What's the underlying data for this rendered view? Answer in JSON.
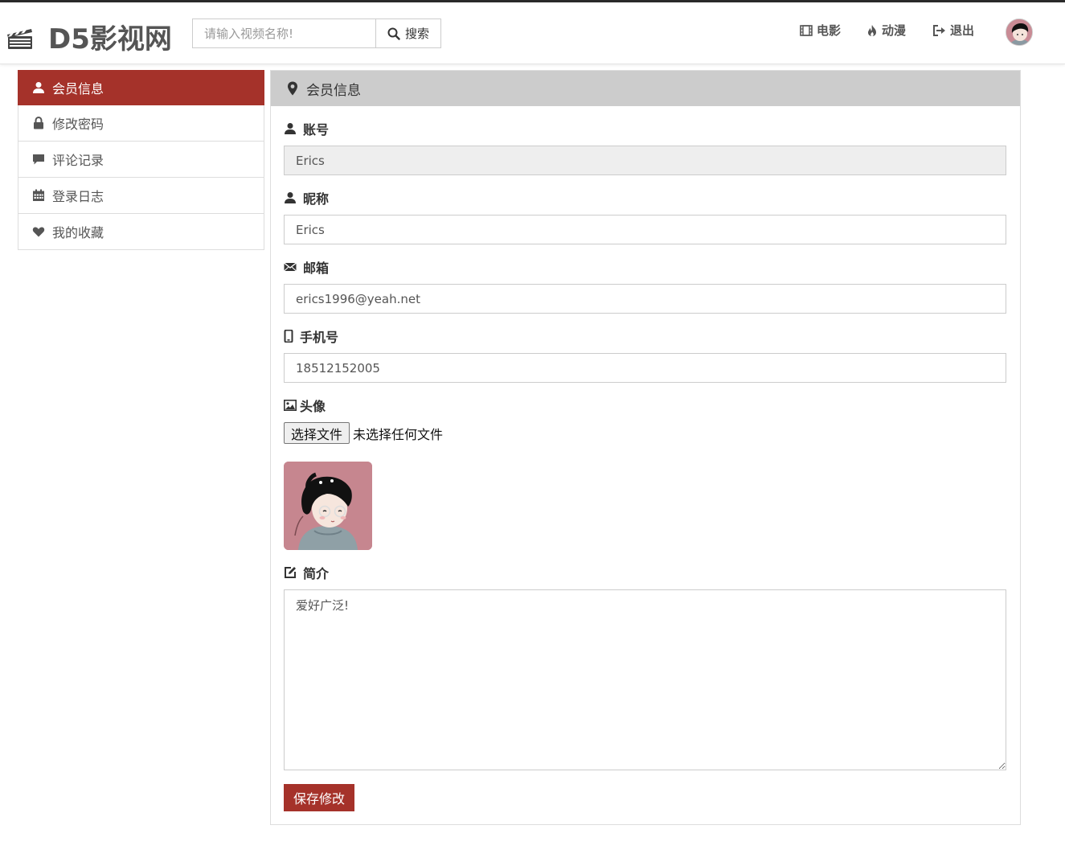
{
  "brand": {
    "name": "D5影视网",
    "logo_icon": "clapperboard-icon"
  },
  "search": {
    "placeholder": "请输入视频名称!",
    "button_label": "搜索",
    "icon": "search-icon"
  },
  "nav": {
    "links": [
      {
        "label": "电影",
        "icon": "film-icon"
      },
      {
        "label": "动漫",
        "icon": "fire-icon"
      },
      {
        "label": "退出",
        "icon": "logout-icon"
      }
    ],
    "avatar_icon": "user-avatar"
  },
  "sidebar": {
    "items": [
      {
        "label": "会员信息",
        "icon": "user-icon",
        "active": true
      },
      {
        "label": "修改密码",
        "icon": "lock-icon",
        "active": false
      },
      {
        "label": "评论记录",
        "icon": "comment-icon",
        "active": false
      },
      {
        "label": "登录日志",
        "icon": "calendar-icon",
        "active": false
      },
      {
        "label": "我的收藏",
        "icon": "heart-icon",
        "active": false
      }
    ]
  },
  "panel": {
    "title": "会员信息",
    "title_icon": "map-marker-icon",
    "fields": {
      "account": {
        "label": "账号",
        "value": "Erics",
        "icon": "user-icon"
      },
      "nickname": {
        "label": "昵称",
        "value": "Erics",
        "icon": "user-icon"
      },
      "email": {
        "label": "邮箱",
        "value": "erics1996@yeah.net",
        "icon": "envelope-icon"
      },
      "phone": {
        "label": "手机号",
        "value": "18512152005",
        "icon": "mobile-icon"
      },
      "avatar": {
        "label": "头像",
        "icon": "picture-icon",
        "file_button": "选择文件",
        "file_status": "未选择任何文件"
      },
      "intro": {
        "label": "简介",
        "value": "爱好广泛!",
        "icon": "edit-icon"
      }
    },
    "save_button": "保存修改"
  },
  "colors": {
    "accent": "#a5322a",
    "panel_heading": "#cccccc",
    "readonly_bg": "#eeeeee"
  }
}
